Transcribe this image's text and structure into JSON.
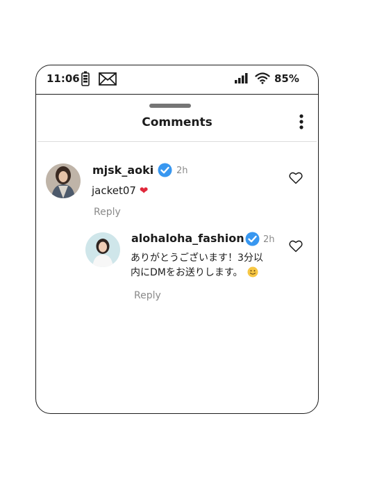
{
  "status_bar": {
    "time": "11:06",
    "battery_percent": "85%"
  },
  "sheet": {
    "title": "Comments"
  },
  "comments": [
    {
      "username": "mjsk_aoki",
      "verified": true,
      "time": "2h",
      "text": "jacket07",
      "emoji": "heart",
      "reply_label": "Reply"
    },
    {
      "username": "alohaloha_fashion",
      "verified": true,
      "time": "2h",
      "text_line1": "ありがとうございます！3分以",
      "text_line2": "内にDMをお送りします。",
      "emoji": "slightly-smiling-face",
      "reply_label": "Reply"
    }
  ],
  "colors": {
    "verified": "#3897f0",
    "heart": "#e0273a",
    "muted": "#8a8a8a"
  }
}
